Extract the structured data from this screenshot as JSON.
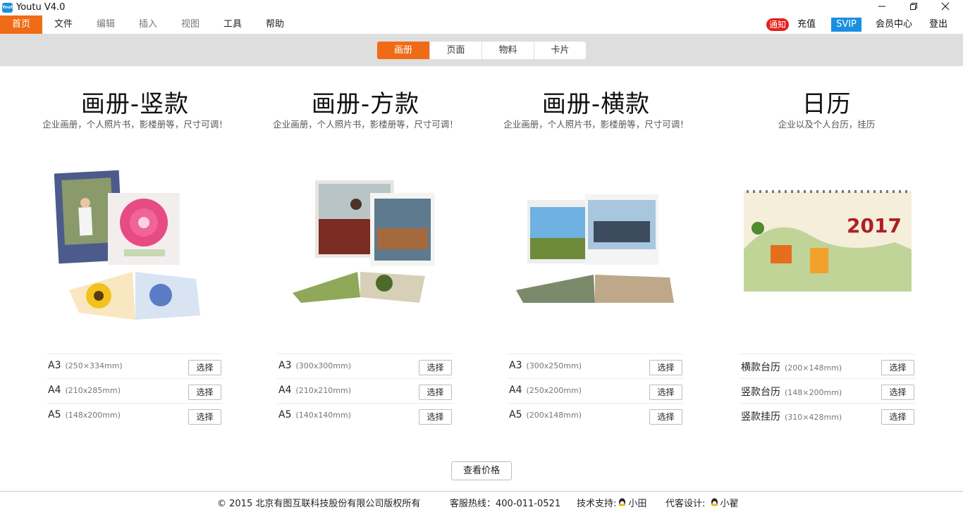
{
  "window": {
    "title": "Youtu V4.0",
    "logo_text": "Youtu"
  },
  "menu": {
    "items": [
      {
        "label": "首页",
        "state": "active"
      },
      {
        "label": "文件",
        "state": "normal"
      },
      {
        "label": "编辑",
        "state": "disabled"
      },
      {
        "label": "插入",
        "state": "disabled"
      },
      {
        "label": "视图",
        "state": "disabled"
      },
      {
        "label": "工具",
        "state": "normal"
      },
      {
        "label": "帮助",
        "state": "normal"
      }
    ],
    "notice": "通知",
    "recharge": "充值",
    "svip": "SVIP",
    "member_center": "会员中心",
    "logout": "登出"
  },
  "tabs": [
    {
      "label": "画册",
      "active": true
    },
    {
      "label": "页面",
      "active": false
    },
    {
      "label": "物料",
      "active": false
    },
    {
      "label": "卡片",
      "active": false
    }
  ],
  "products": [
    {
      "title": "画册-竖款",
      "subtitle": "企业画册，个人照片书，影楼册等，尺寸可调！",
      "options": [
        {
          "name": "A3",
          "size": "(250×334mm)",
          "button": "选择"
        },
        {
          "name": "A4",
          "size": "(210x285mm)",
          "button": "选择"
        },
        {
          "name": "A5",
          "size": "(148x200mm)",
          "button": "选择"
        }
      ]
    },
    {
      "title": "画册-方款",
      "subtitle": "企业画册，个人照片书，影楼册等，尺寸可调！",
      "options": [
        {
          "name": "A3",
          "size": "(300x300mm)",
          "button": "选择"
        },
        {
          "name": "A4",
          "size": "(210x210mm)",
          "button": "选择"
        },
        {
          "name": "A5",
          "size": "(140x140mm)",
          "button": "选择"
        }
      ]
    },
    {
      "title": "画册-横款",
      "subtitle": "企业画册，个人照片书，影楼册等，尺寸可调！",
      "options": [
        {
          "name": "A3",
          "size": "(300x250mm)",
          "button": "选择"
        },
        {
          "name": "A4",
          "size": "(250x200mm)",
          "button": "选择"
        },
        {
          "name": "A5",
          "size": "(200x148mm)",
          "button": "选择"
        }
      ]
    },
    {
      "title": "日历",
      "subtitle": "企业以及个人台历，挂历",
      "image_text": "2017",
      "options": [
        {
          "name": "横款台历",
          "size": "(200×148mm)",
          "button": "选择"
        },
        {
          "name": "竖款台历",
          "size": "(148×200mm)",
          "button": "选择"
        },
        {
          "name": "竖款挂历",
          "size": "(310×428mm)",
          "button": "选择"
        }
      ]
    }
  ],
  "price_button": "查看价格",
  "footer": {
    "copyright": "© 2015 北京有图互联科技股份有限公司版权所有",
    "hotline": "客服热线：400-011-0521",
    "tech_support_label": "技术支持:",
    "tech_support_name": "小田",
    "design_label": "代客设计:",
    "design_name": "小翟"
  },
  "colors": {
    "accent": "#f06b16",
    "svip": "#1a8fe0",
    "notice": "#e5201e"
  }
}
